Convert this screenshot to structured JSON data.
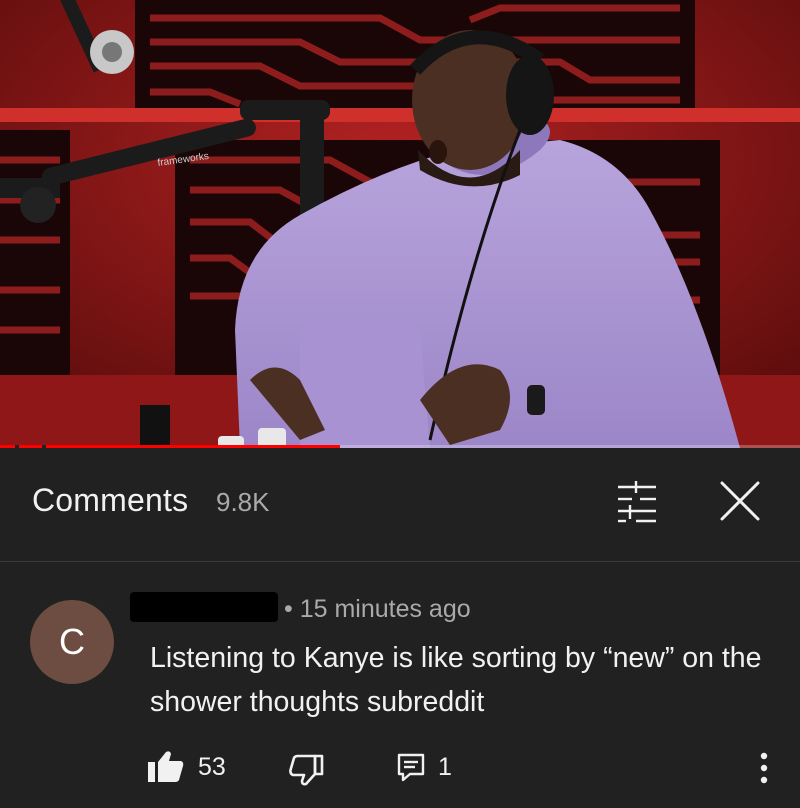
{
  "video": {
    "progress_fraction": 0.425,
    "studio_watermark": "frameworks"
  },
  "comments_panel": {
    "title": "Comments",
    "count": "9.8K",
    "filter_icon": "sort-filter-icon",
    "close_icon": "close-icon"
  },
  "comment": {
    "avatar_letter": "C",
    "avatar_color": "#6d4c41",
    "meta": "• 15 minutes ago",
    "text": "Listening to Kanye is like sorting by “new” on the shower thoughts subreddit",
    "like_count": "53",
    "reply_count": "1"
  },
  "colors": {
    "background": "#212121",
    "progress": "#ff0000",
    "secondary_text": "#aaaaaa"
  }
}
